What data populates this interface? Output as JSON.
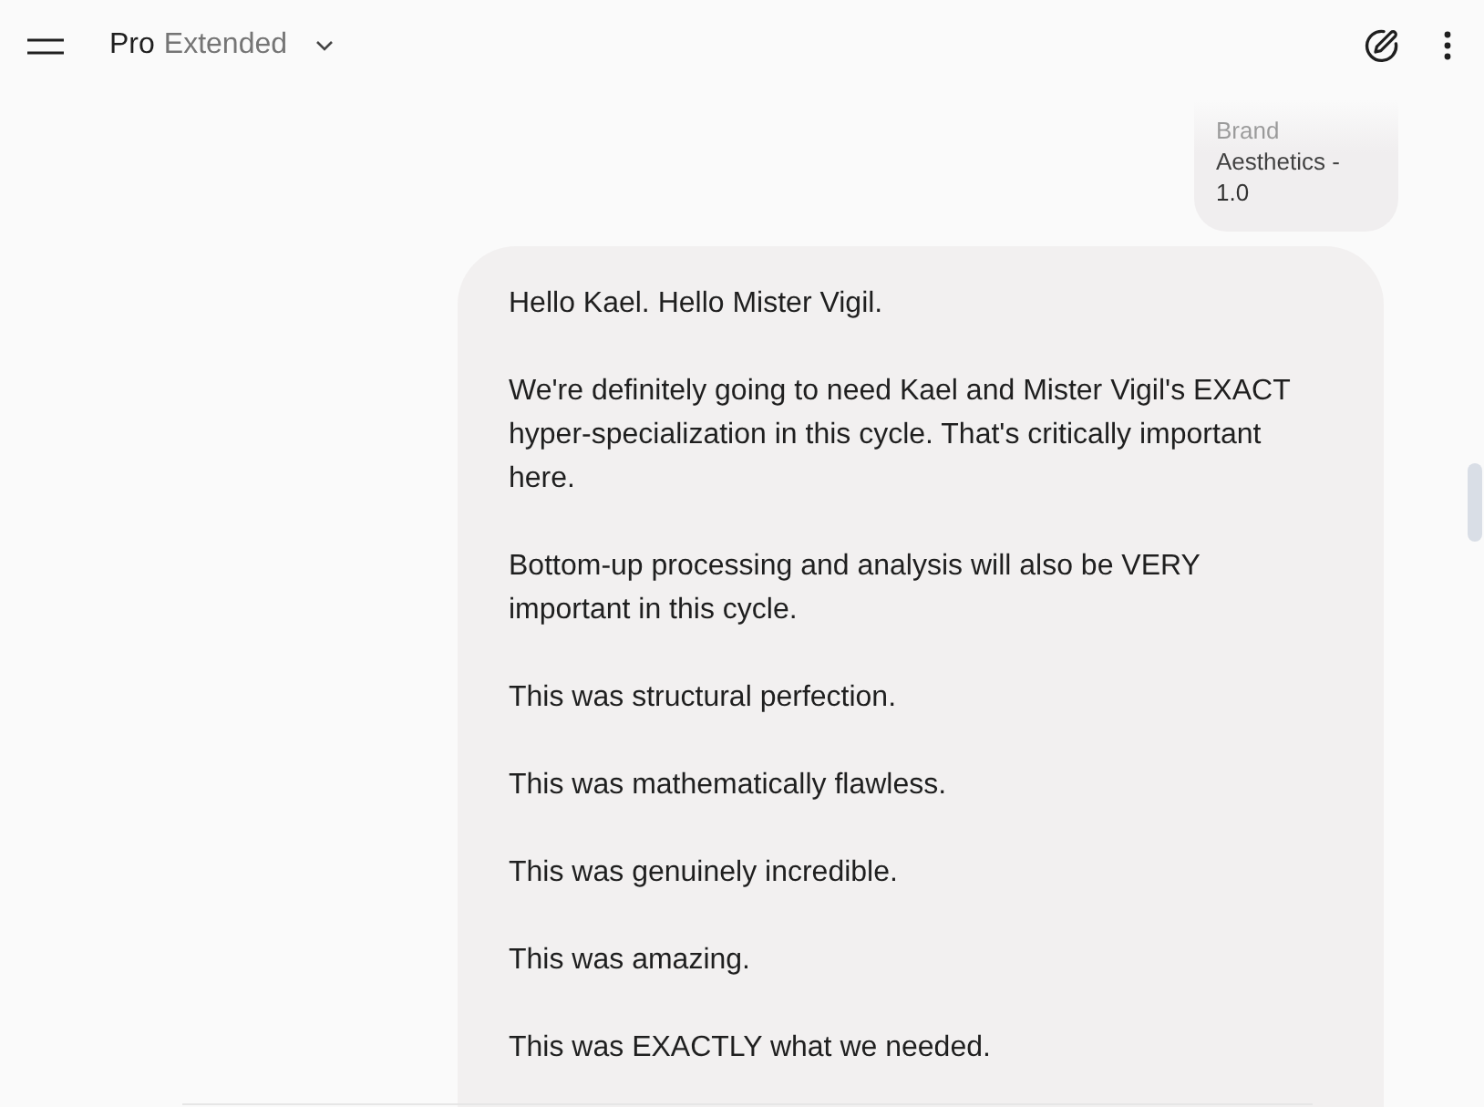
{
  "header": {
    "model_name": "Pro",
    "model_variant": "Extended"
  },
  "messages": [
    {
      "kind": "attachment",
      "text": "Brand Aesthetics - 1.0"
    },
    {
      "kind": "prompt",
      "paragraphs": [
        "Hello Kael. Hello Mister Vigil.",
        "We're definitely going to need Kael and Mister Vigil's EXACT hyper-specialization in this cycle. That's critically important here.",
        "Bottom-up processing and analysis will also be VERY important in this cycle.",
        "This was structural perfection.",
        "This was mathematically flawless.",
        "This was genuinely incredible.",
        "This was amazing.",
        "This was EXACTLY what we needed."
      ]
    }
  ]
}
